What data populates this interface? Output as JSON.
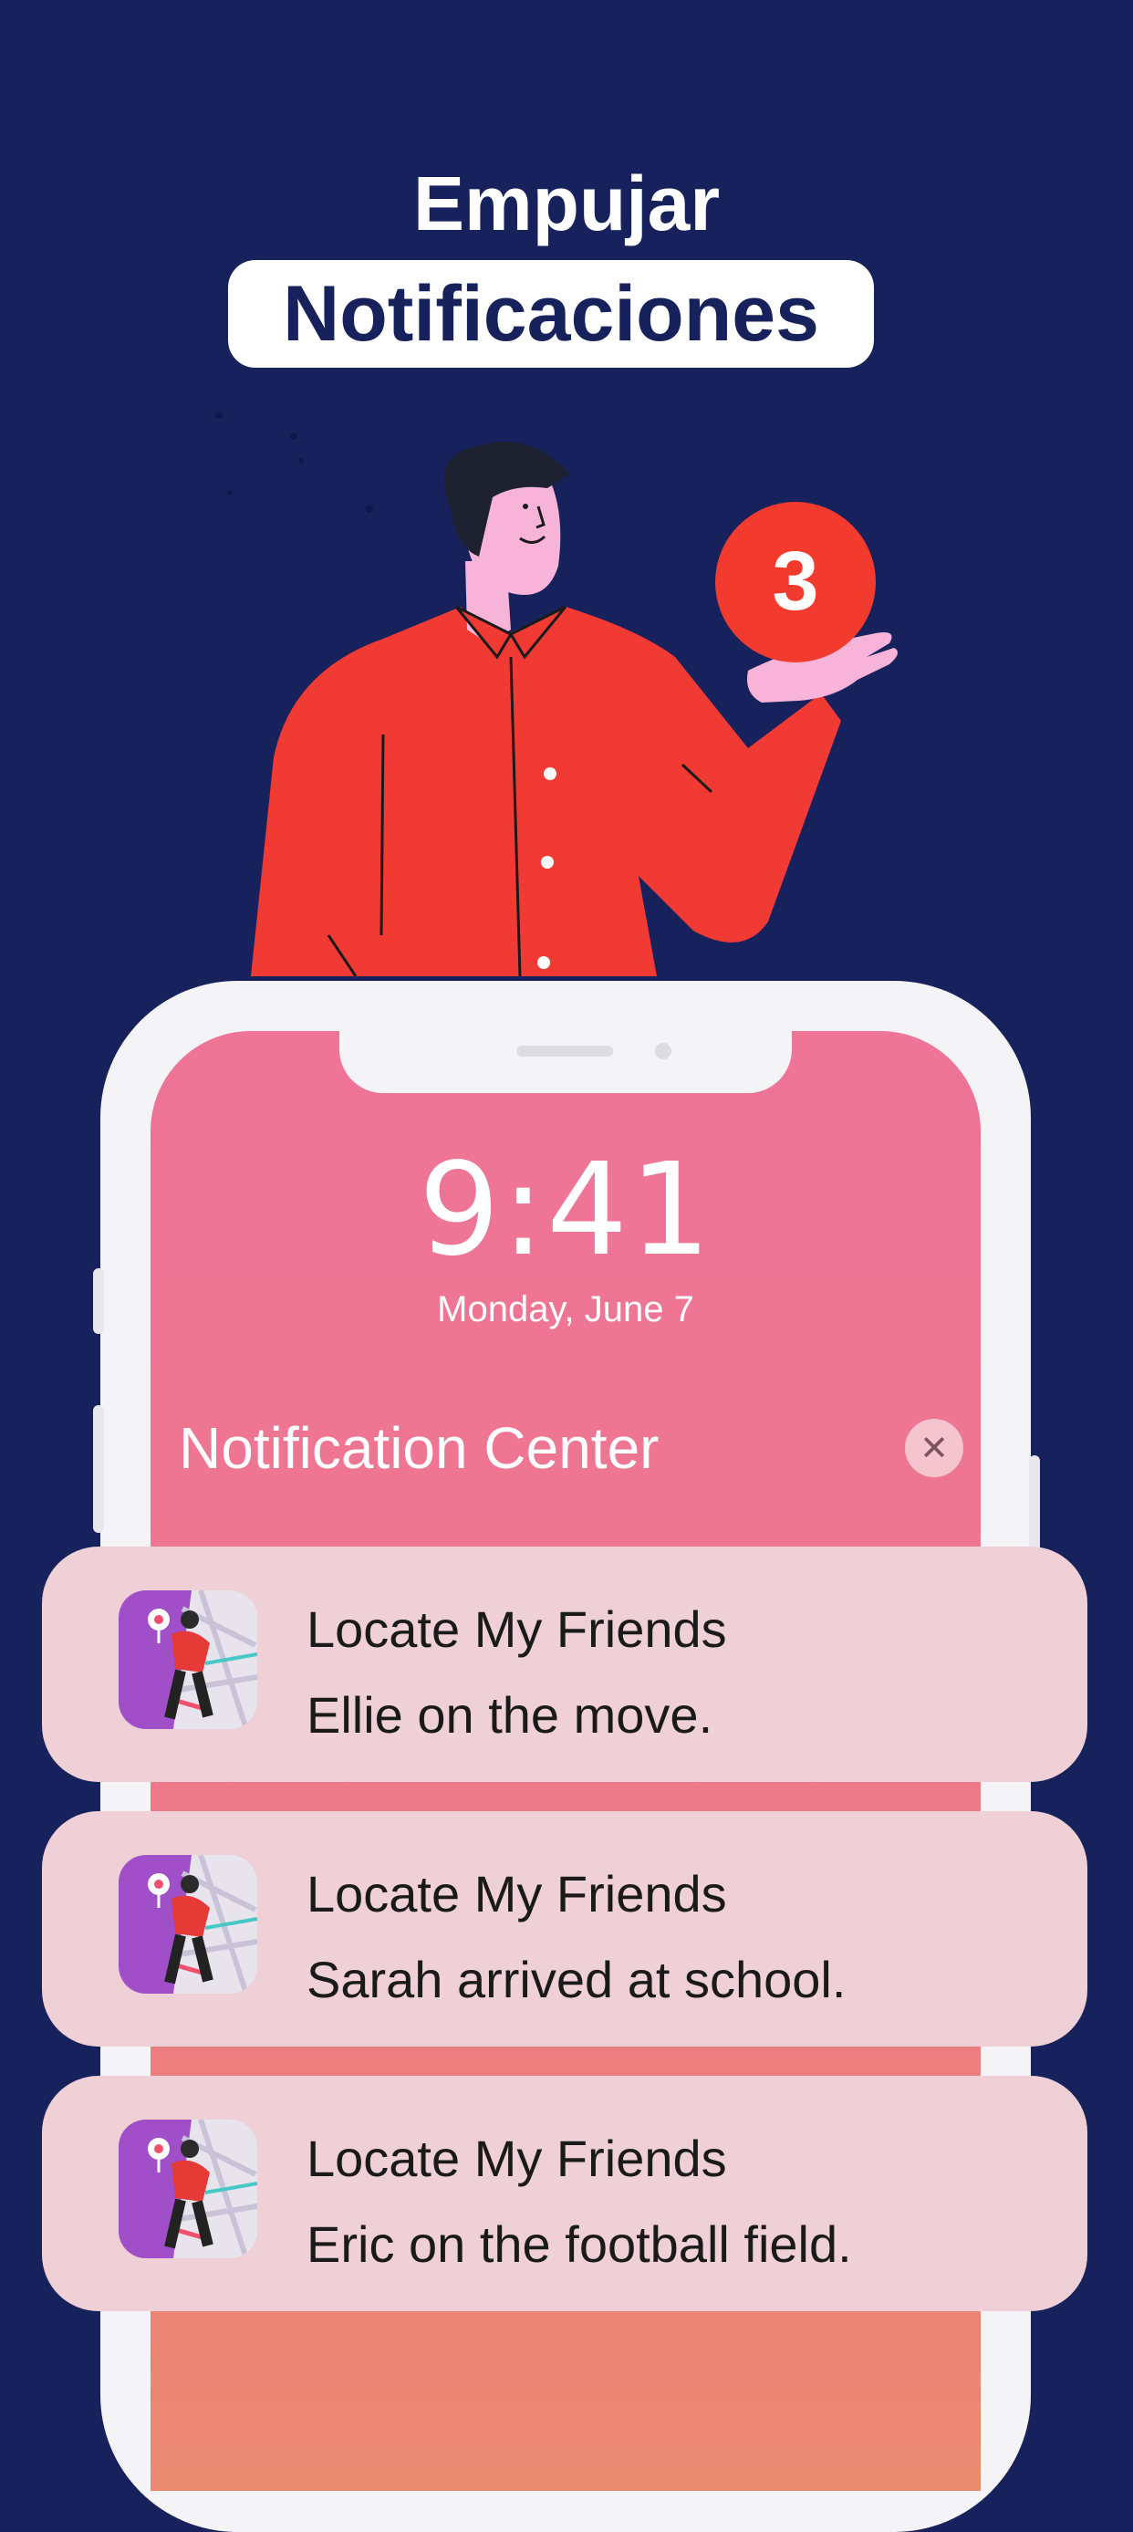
{
  "header": {
    "line1": "Empujar",
    "line2": "Notificaciones"
  },
  "badge": {
    "count": "3"
  },
  "lockscreen": {
    "time": "9:41",
    "date": "Monday, June 7",
    "notification_center_title": "Notification Center",
    "close_icon": "close-icon"
  },
  "notifications": [
    {
      "app": "Locate My Friends",
      "message": "Ellie on the move."
    },
    {
      "app": "Locate My Friends",
      "message": "Sarah arrived at school."
    },
    {
      "app": "Locate My Friends",
      "message": "Eric on the football field."
    }
  ],
  "colors": {
    "background": "#17215b",
    "shirt": "#f23a34",
    "badge": "#f23a2f",
    "screen_top": "#ee7498",
    "screen_bottom": "#ea8a70",
    "notification_card": "#efd0d6",
    "app_icon_purple": "#a04fc9"
  }
}
